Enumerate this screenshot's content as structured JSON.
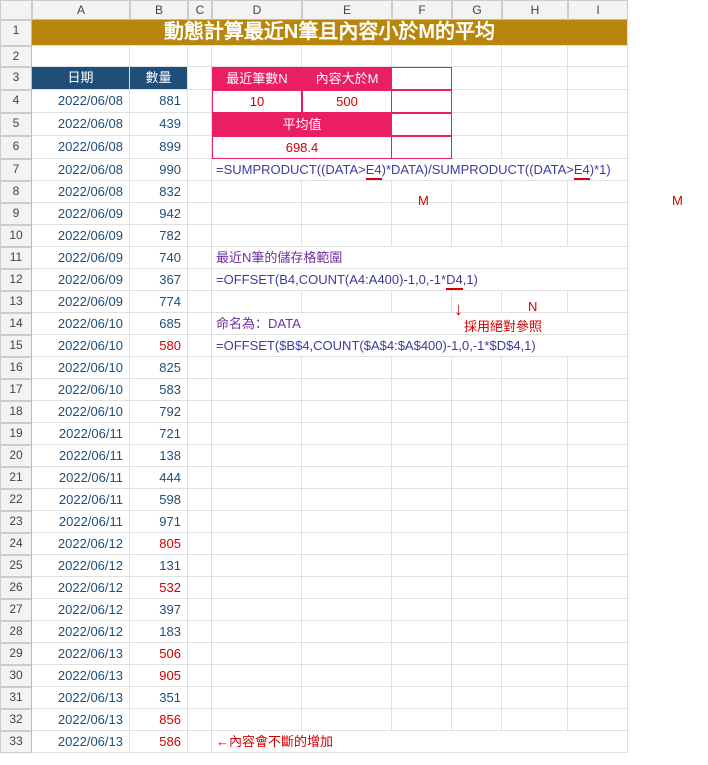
{
  "cols": [
    "A",
    "B",
    "C",
    "D",
    "E",
    "F",
    "G",
    "H",
    "I"
  ],
  "rows_count": 33,
  "title": "動態計算最近N筆且內容小於M的平均",
  "headers": {
    "a": "日期",
    "b": "數量"
  },
  "pinkbox": {
    "n_label": "最近筆數N",
    "m_label": "內容大於M",
    "n_val": "10",
    "m_val": "500",
    "avg_label": "平均值",
    "avg_val": "698.4"
  },
  "formula7": "=SUMPRODUCT((DATA>E4)*DATA)/SUMPRODUCT((DATA>E4)*1)",
  "under_M1": "M",
  "under_M2": "M",
  "note11": "最近N筆的儲存格範圍",
  "formula12": "=OFFSET(B4,COUNT(A4:A400)-1,0,-1*D4,1)",
  "under_N": "N",
  "note13": "採用絕對參照",
  "note14": "命名為：DATA",
  "formula15": "=OFFSET($B$4,COUNT($A$4:$A$400)-1,0,-1*$D$4,1)",
  "note33": "←內容會不斷的增加",
  "data": [
    {
      "d": "2022/06/08",
      "v": "881"
    },
    {
      "d": "2022/06/08",
      "v": "439"
    },
    {
      "d": "2022/06/08",
      "v": "899"
    },
    {
      "d": "2022/06/08",
      "v": "990"
    },
    {
      "d": "2022/06/08",
      "v": "832"
    },
    {
      "d": "2022/06/09",
      "v": "942"
    },
    {
      "d": "2022/06/09",
      "v": "782"
    },
    {
      "d": "2022/06/09",
      "v": "740"
    },
    {
      "d": "2022/06/09",
      "v": "367"
    },
    {
      "d": "2022/06/09",
      "v": "774"
    },
    {
      "d": "2022/06/10",
      "v": "685"
    },
    {
      "d": "2022/06/10",
      "v": "580",
      "r": true
    },
    {
      "d": "2022/06/10",
      "v": "825"
    },
    {
      "d": "2022/06/10",
      "v": "583"
    },
    {
      "d": "2022/06/10",
      "v": "792"
    },
    {
      "d": "2022/06/11",
      "v": "721"
    },
    {
      "d": "2022/06/11",
      "v": "138"
    },
    {
      "d": "2022/06/11",
      "v": "444"
    },
    {
      "d": "2022/06/11",
      "v": "598"
    },
    {
      "d": "2022/06/11",
      "v": "971"
    },
    {
      "d": "2022/06/12",
      "v": "805",
      "r": true
    },
    {
      "d": "2022/06/12",
      "v": "131"
    },
    {
      "d": "2022/06/12",
      "v": "532",
      "r": true
    },
    {
      "d": "2022/06/12",
      "v": "397"
    },
    {
      "d": "2022/06/12",
      "v": "183"
    },
    {
      "d": "2022/06/13",
      "v": "506",
      "r": true
    },
    {
      "d": "2022/06/13",
      "v": "905",
      "r": true
    },
    {
      "d": "2022/06/13",
      "v": "351"
    },
    {
      "d": "2022/06/13",
      "v": "856",
      "r": true
    },
    {
      "d": "2022/06/13",
      "v": "586",
      "r": true
    }
  ]
}
